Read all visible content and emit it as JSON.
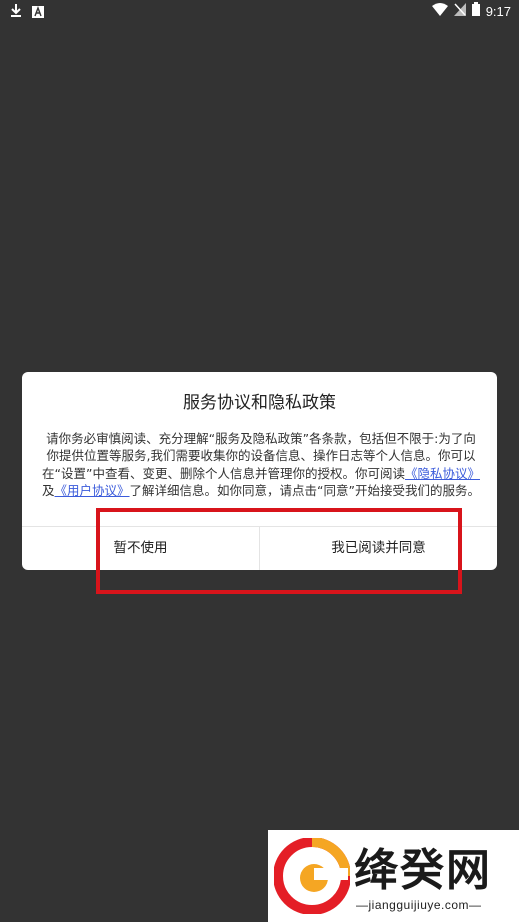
{
  "status_bar": {
    "time": "9:17",
    "icons": [
      "download-icon",
      "font-a-icon",
      "wifi-icon",
      "signal-off-icon",
      "battery-icon"
    ]
  },
  "dialog": {
    "title": "服务协议和隐私政策",
    "body": {
      "text_1": "请你务必审慎阅读、充分理解“服务及隐私政策”各条款，包括但不限于:为了向你提供位置等服务,我们需要收集你的设备信息、操作日志等个人信息。你可以在“设置”中查看、变更、删除个人信息并管理你的授权。你可阅读",
      "privacy_link": "《隐私协议》",
      "connector": "及",
      "user_link": "《用户协议》",
      "text_2": "了解详细信息。如你同意，请点击“同意”开始接受我们的服务。"
    },
    "decline_label": "暂不使用",
    "agree_label": "我已阅读并同意"
  },
  "watermark": {
    "name": "绛癸网",
    "url": "—jiangguijiuye.com—"
  },
  "colors": {
    "background": "#333333",
    "annotation": "#d8141b",
    "link": "#3b5bdb"
  }
}
